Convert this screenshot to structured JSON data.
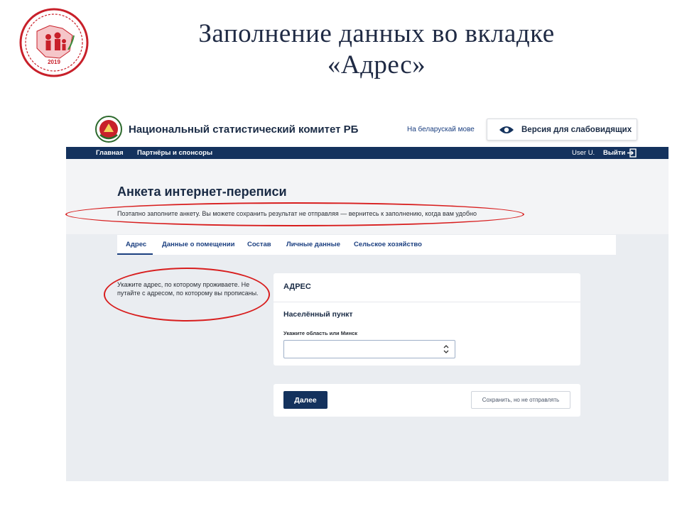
{
  "slide": {
    "title_line1": "Заполнение данных во вкладке",
    "title_line2": "«Адрес»",
    "logo_year": "2019"
  },
  "site": {
    "name": "Национальный статистический комитет РБ",
    "lang_link": "На беларускай мове",
    "vision_button": "Версия для слабовидящих"
  },
  "nav": {
    "items": [
      "Главная",
      "Партнёры и спонсоры"
    ],
    "user": "User U.",
    "logout": "Выйти"
  },
  "page": {
    "title": "Анкета интернет-переписи",
    "subtitle": "Поэтапно заполните анкету. Вы можете сохранить результат не отправляя — вернитесь к заполнению, когда вам удобно"
  },
  "tabs": [
    "Адрес",
    "Данные о помещении",
    "Состав",
    "Личные данные",
    "Сельское хозяйство"
  ],
  "hint": "Укажите адрес, по которому проживаете. Не путайте с адресом, по которому вы прописаны.",
  "address_card": {
    "title": "АДРЕС",
    "field_title": "Населённый пункт",
    "field_label": "Укажите область или Минск",
    "select_value": ""
  },
  "actions": {
    "next": "Далее",
    "save": "Сохранить, но не отправлять"
  },
  "colors": {
    "navy": "#14325d",
    "link": "#1b3f80",
    "annotation": "#d81e1e",
    "logo_red": "#c8202a"
  }
}
